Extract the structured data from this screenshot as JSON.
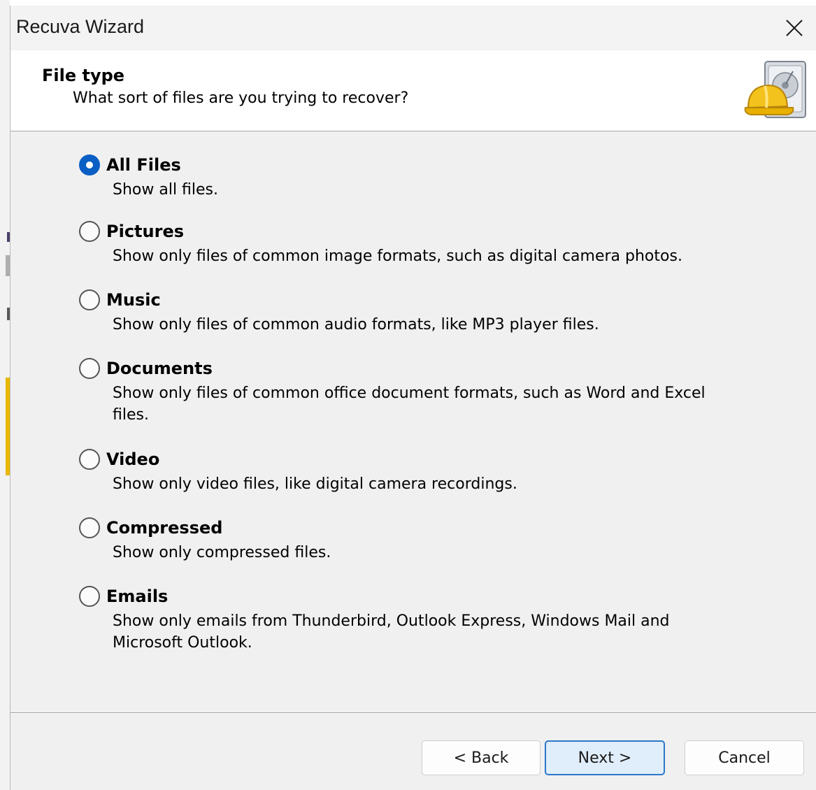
{
  "window": {
    "title": "Recuva Wizard"
  },
  "header": {
    "title": "File type",
    "subtitle": "What sort of files are you trying to recover?"
  },
  "options": [
    {
      "label": "All Files",
      "description": "Show all files.",
      "checked": true
    },
    {
      "label": "Pictures",
      "description": "Show only files of common image formats, such as digital camera photos.",
      "checked": false
    },
    {
      "label": "Music",
      "description": "Show only files of common audio formats, like MP3 player files.",
      "checked": false
    },
    {
      "label": "Documents",
      "description": "Show only files of common office document formats, such as Word and Excel files.",
      "checked": false
    },
    {
      "label": "Video",
      "description": "Show only video files, like digital camera recordings.",
      "checked": false
    },
    {
      "label": "Compressed",
      "description": "Show only compressed files.",
      "checked": false
    },
    {
      "label": "Emails",
      "description": "Show only emails from Thunderbird, Outlook Express, Windows Mail and Microsoft Outlook.",
      "checked": false
    }
  ],
  "buttons": {
    "back": "< Back",
    "next": "Next >",
    "cancel": "Cancel"
  },
  "icons": {
    "close": "close-icon",
    "header": "recuva-hardhat-drive-icon"
  },
  "colors": {
    "accent": "#0a5ec4",
    "primary_button_bg": "#e0eefb",
    "primary_button_border": "#2b78c9"
  }
}
